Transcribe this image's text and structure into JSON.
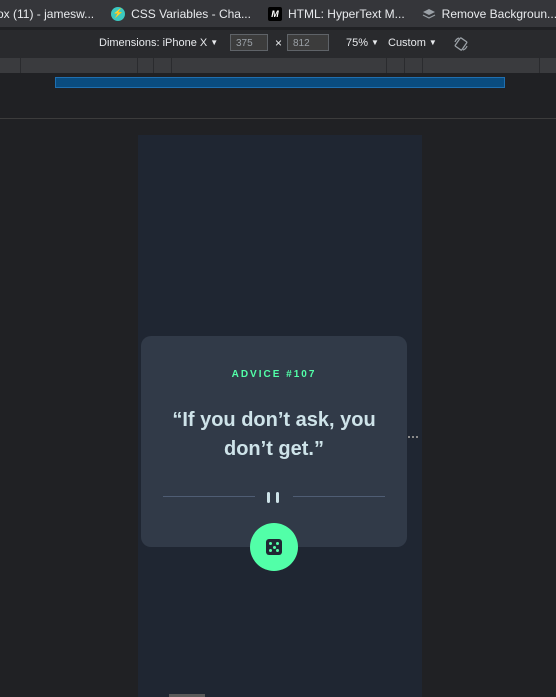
{
  "bookmarks": [
    {
      "label": "ox (11) - jamesw...",
      "icon": "inbox-icon"
    },
    {
      "label": "CSS Variables - Cha...",
      "icon": "css-tricks-icon"
    },
    {
      "label": "HTML: HyperText M...",
      "icon": "mdn-icon"
    },
    {
      "label": "Remove Backgroun...",
      "icon": "remove-bg-icon"
    }
  ],
  "devtools": {
    "dimensions_label": "Dimensions: iPhone X",
    "width": "375",
    "times": "×",
    "height": "812",
    "zoom": "75%",
    "throttle": "Custom"
  },
  "advice": {
    "id_label": "ADVICE #107",
    "quote": "“If you don’t ask, you don’t get.”"
  },
  "colors": {
    "accent": "#52ffa8",
    "card": "#313a48",
    "page": "#1f2632",
    "quote_text": "#cee3e9"
  }
}
